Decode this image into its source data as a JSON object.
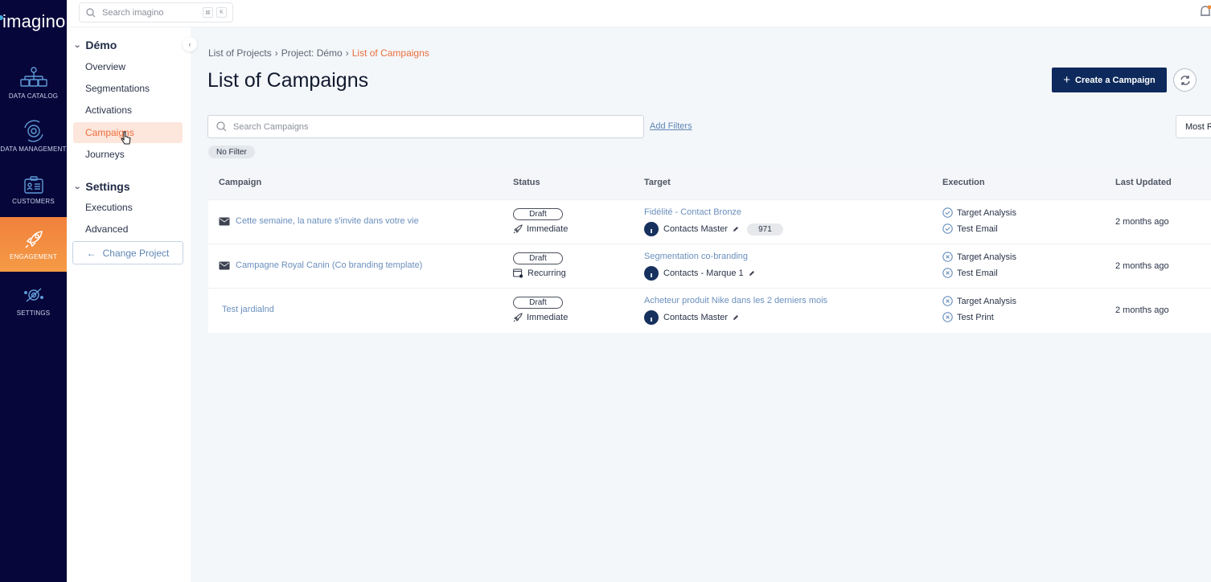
{
  "app": {
    "logo": "imagino",
    "brand_colors": {
      "navy": "#07063a",
      "accent_orange": "#f0813c",
      "primary_button": "#0e2a5c",
      "link_blue": "#6a8fbd"
    }
  },
  "rail": {
    "items": [
      {
        "label": "DATA CATALOG",
        "icon": "data-catalog-icon",
        "active": false
      },
      {
        "label": "DATA MANAGEMENT",
        "icon": "data-management-icon",
        "active": false
      },
      {
        "label": "CUSTOMERS",
        "icon": "customers-icon",
        "active": false
      },
      {
        "label": "ENGAGEMENT",
        "icon": "rocket-icon",
        "active": true
      },
      {
        "label": "SETTINGS",
        "icon": "settings-icon",
        "active": false
      }
    ]
  },
  "topbar": {
    "search_placeholder": "Search imagino",
    "shortcut_keys": [
      "⌘",
      "K"
    ]
  },
  "sidemenu": {
    "groups": [
      {
        "title": "Démo",
        "items": [
          {
            "label": "Overview",
            "active": false
          },
          {
            "label": "Segmentations",
            "active": false
          },
          {
            "label": "Activations",
            "active": false
          },
          {
            "label": "Campaigns",
            "active": true
          },
          {
            "label": "Journeys",
            "active": false
          }
        ]
      },
      {
        "title": "Settings",
        "items": [
          {
            "label": "Executions",
            "active": false
          },
          {
            "label": "Advanced",
            "active": false
          }
        ]
      }
    ],
    "change_project_label": "Change Project"
  },
  "main": {
    "breadcrumb": [
      "List of Projects",
      "Project: Démo",
      "List of Campaigns"
    ],
    "breadcrumb_sep": "›",
    "title": "List of Campaigns",
    "create_button": "Create a Campaign",
    "search_placeholder": "Search Campaigns",
    "add_filters": "Add Filters",
    "sort_label": "Most Recent",
    "filter_chip": "No Filter",
    "table": {
      "columns": [
        "Campaign",
        "Status",
        "Target",
        "Execution",
        "Last Updated"
      ],
      "rows": [
        {
          "campaign": "Cette semaine, la nature s'invite dans votre vie",
          "campaign_icon": "email-icon",
          "status": "Draft",
          "mode": "Immediate",
          "mode_icon": "rocket-icon",
          "target_segment": "Fidélité - Contact Bronze",
          "target_db": "Contacts Master",
          "target_count": "971",
          "executions": [
            {
              "label": "Target Analysis",
              "state": "success"
            },
            {
              "label": "Test Email",
              "state": "success"
            }
          ],
          "last_updated": "2 months ago"
        },
        {
          "campaign": "Campagne Royal Canin (Co branding template)",
          "campaign_icon": "email-icon",
          "status": "Draft",
          "mode": "Recurring",
          "mode_icon": "calendar-icon",
          "target_segment": "Segmentation co-branding",
          "target_db": "Contacts - Marque 1",
          "target_count": null,
          "executions": [
            {
              "label": "Target Analysis",
              "state": "not-run"
            },
            {
              "label": "Test Email",
              "state": "not-run"
            }
          ],
          "last_updated": "2 months ago"
        },
        {
          "campaign": "Test jardialnd",
          "campaign_icon": null,
          "status": "Draft",
          "mode": "Immediate",
          "mode_icon": "rocket-icon",
          "target_segment": "Acheteur produit Nike dans les 2 derniers mois",
          "target_db": "Contacts Master",
          "target_count": null,
          "executions": [
            {
              "label": "Target Analysis",
              "state": "not-run"
            },
            {
              "label": "Test Print",
              "state": "not-run"
            }
          ],
          "last_updated": "2 months ago"
        }
      ]
    }
  }
}
